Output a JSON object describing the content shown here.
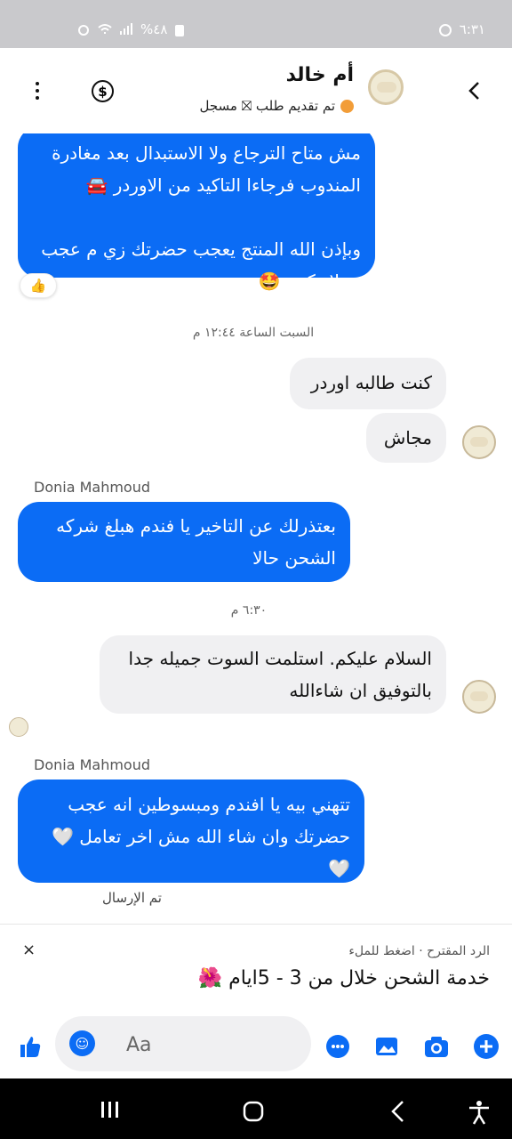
{
  "status_bar": {
    "time": "٦:٣١",
    "battery": "%٤٨"
  },
  "header": {
    "contact_name": "أم خالد",
    "status_text": "تم تقديم طلب ⛝ مسجل",
    "icons": [
      "back-icon",
      "avatar",
      "dollar-icon",
      "more-icon"
    ]
  },
  "messages": [
    {
      "id": "m1",
      "type": "outgoing",
      "text": "مش متاح الترجاع ولا الاستبدال بعد مغادرة المندوب فرجاءا التاكيد من الاوردر 🚘\n\nوبإذن الله المنتج يعجب حضرتك زي م عجب عملاء كتير 🤩"
    },
    {
      "id": "reaction",
      "type": "reaction",
      "emoji": "👍"
    },
    {
      "id": "t1",
      "type": "timestamp",
      "text": "السبت الساعة ١٢:٤٤ م"
    },
    {
      "id": "m2",
      "type": "incoming",
      "text": "كنت طالبه اوردر"
    },
    {
      "id": "m3",
      "type": "incoming",
      "text": "مجاش"
    },
    {
      "id": "s1",
      "type": "sender",
      "text": "Donia Mahmoud"
    },
    {
      "id": "m4",
      "type": "outgoing",
      "text": "بعتذرلك عن التاخير يا فندم هبلغ شركه الشحن حالا"
    },
    {
      "id": "t2",
      "type": "timestamp",
      "text": "٦:٣٠ م"
    },
    {
      "id": "m5",
      "type": "incoming",
      "text": "السلام عليكم. استلمت السوت جميله جدا بالتوفيق ان شاءالله"
    },
    {
      "id": "s2",
      "type": "sender",
      "text": "Donia Mahmoud"
    },
    {
      "id": "m6",
      "type": "outgoing",
      "text": "تتهني بيه يا افندم ومبسوطين انه عجب حضرتك وان شاء الله مش اخر تعامل 🤍\n🤍"
    },
    {
      "id": "sent",
      "type": "status",
      "text": "تم الإرسال"
    }
  ],
  "suggestion": {
    "caption": "الرد المقترح · اضغط للملء",
    "text": "خدمة الشحن خلال من 3 - 5ايام 🌺",
    "close_label": "×"
  },
  "composer": {
    "placeholder": "Aa"
  },
  "colors": {
    "accent": "#0b6cf5",
    "incoming_bg": "#f0f0f2",
    "status_bar": "#c9c9cc"
  }
}
